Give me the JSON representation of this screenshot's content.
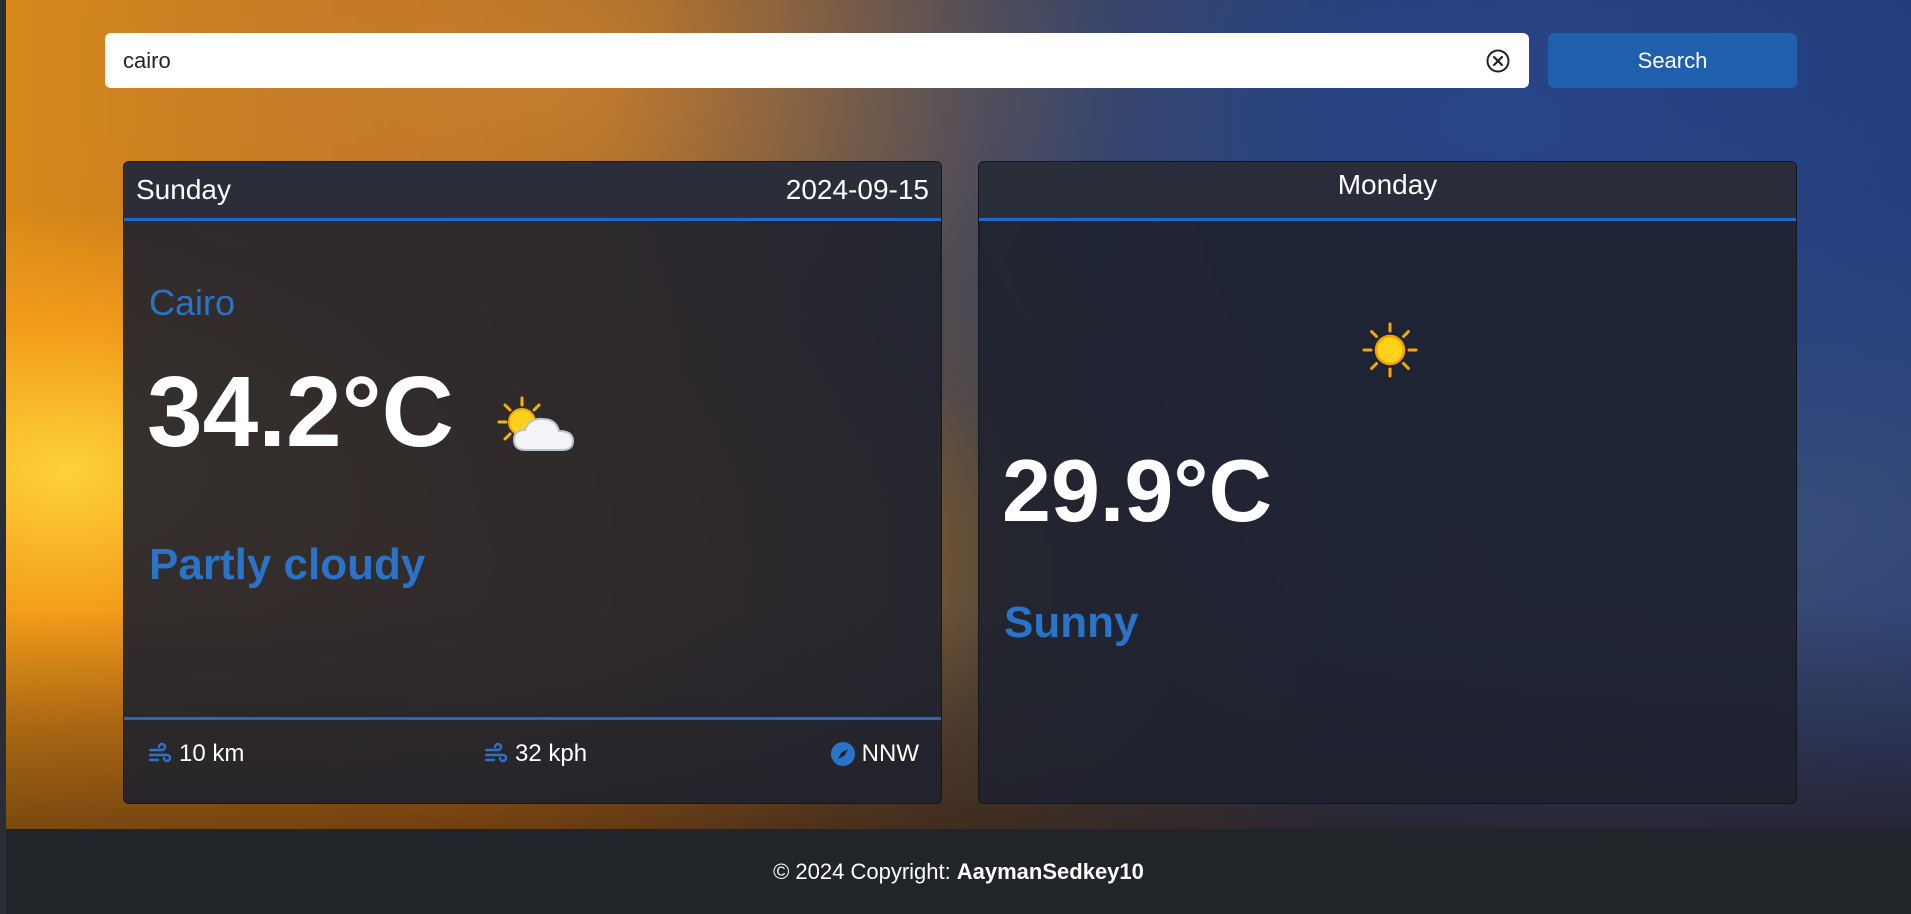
{
  "search": {
    "value": "cairo",
    "button_label": "Search"
  },
  "today": {
    "day": "Sunday",
    "date": "2024-09-15",
    "city": "Cairo",
    "temperature": "34.2°C",
    "condition": "Partly cloudy",
    "condition_icon": "partly-cloudy-icon",
    "stats": {
      "visibility": "10 km",
      "wind_speed": "32 kph",
      "wind_direction": "NNW"
    }
  },
  "tomorrow": {
    "day": "Monday",
    "temperature": "29.9°C",
    "condition": "Sunny",
    "condition_icon": "sun-icon"
  },
  "footer": {
    "prefix": "© 2024 Copyright:",
    "author": "AaymanSedkey10"
  },
  "colors": {
    "accent": "#1f6ac9",
    "city_text": "#2a73c8",
    "button": "#1f5fad",
    "footer_bg": "#212429"
  }
}
